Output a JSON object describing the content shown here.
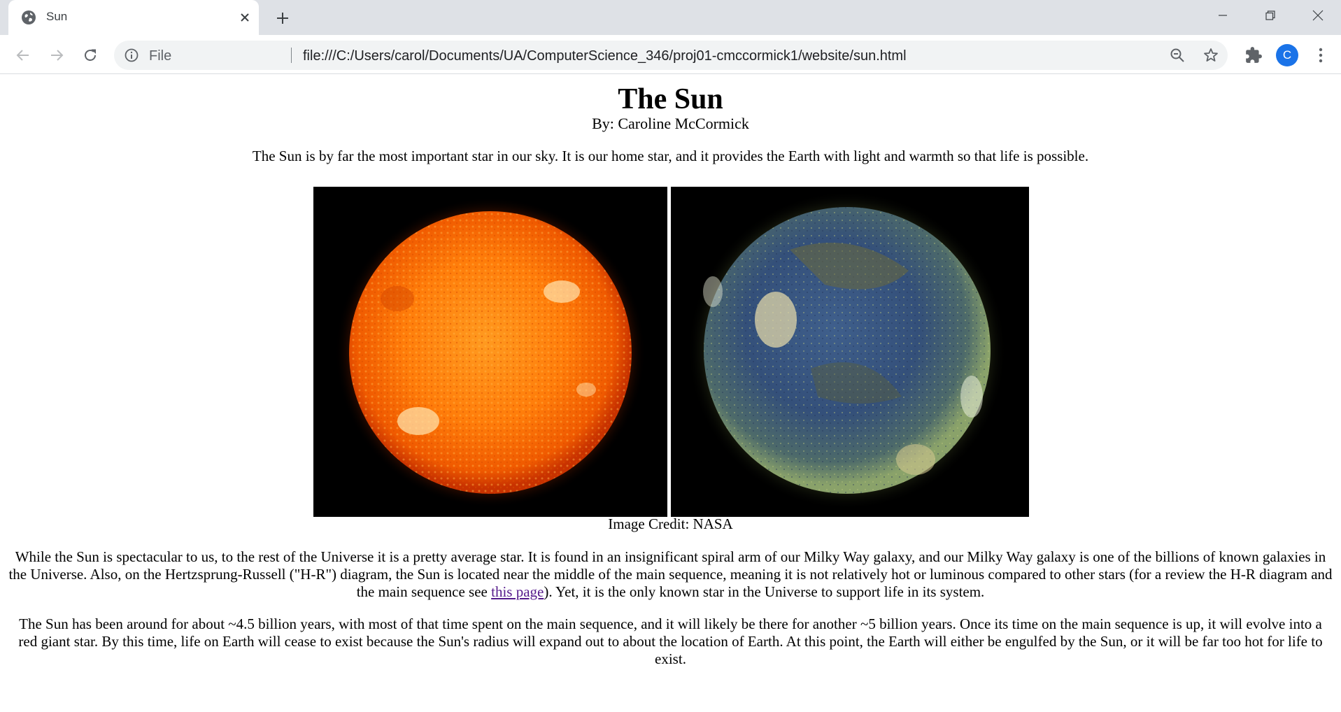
{
  "browser": {
    "tab": {
      "title": "Sun",
      "favicon": "globe-icon"
    },
    "address_bar": {
      "scheme_label": "File",
      "url": "file:///C:/Users/carol/Documents/UA/ComputerScience_346/proj01-cmccormick1/website/sun.html"
    },
    "profile_initial": "C",
    "icons": [
      "back-arrow-icon",
      "forward-arrow-icon",
      "reload-icon",
      "info-icon",
      "zoom-out-icon",
      "star-icon",
      "extensions-icon",
      "more-vert-icon",
      "minimize-icon",
      "restore-icon",
      "close-icon",
      "plus-icon"
    ],
    "colors": {
      "tabstrip": "#dee1e6",
      "omnibox": "#f1f3f4",
      "avatar": "#1a73e8"
    }
  },
  "page": {
    "title": "The Sun",
    "byline": "By: Caroline McCormick",
    "intro": "The Sun is by far the most important star in our sky. It is our home star, and it provides the Earth with light and warmth so that life is possible.",
    "image_credit": "Image Credit: NASA",
    "paragraph1": {
      "before_link": "While the Sun is spectacular to us, to the rest of the Universe it is a pretty average star. It is found in an insignificant spiral arm of our Milky Way galaxy, and our Milky Way galaxy is one of the billions of known galaxies in the Universe. Also, on the Hertzsprung-Russell (\"H-R\") diagram, the Sun is located near the middle of the main sequence, meaning it is not relatively hot or luminous compared to other stars (for a review the H-R diagram and the main sequence see ",
      "link_text": "this page",
      "after_link": "). Yet, it is the only known star in the Universe to support life in its system."
    },
    "paragraph2": "The Sun has been around for about ~4.5 billion years, with most of that time spent on the main sequence, and it will likely be there for another ~5 billion years. Once its time on the main sequence is up, it will evolve into a red giant star. By this time, life on Earth will cease to exist because the Sun's radius will expand out to about the location of Earth. At this point, the Earth will either be engulfed by the Sun, or it will be far too hot for life to exist.",
    "colors": {
      "link_visited": "#551a8b"
    }
  }
}
